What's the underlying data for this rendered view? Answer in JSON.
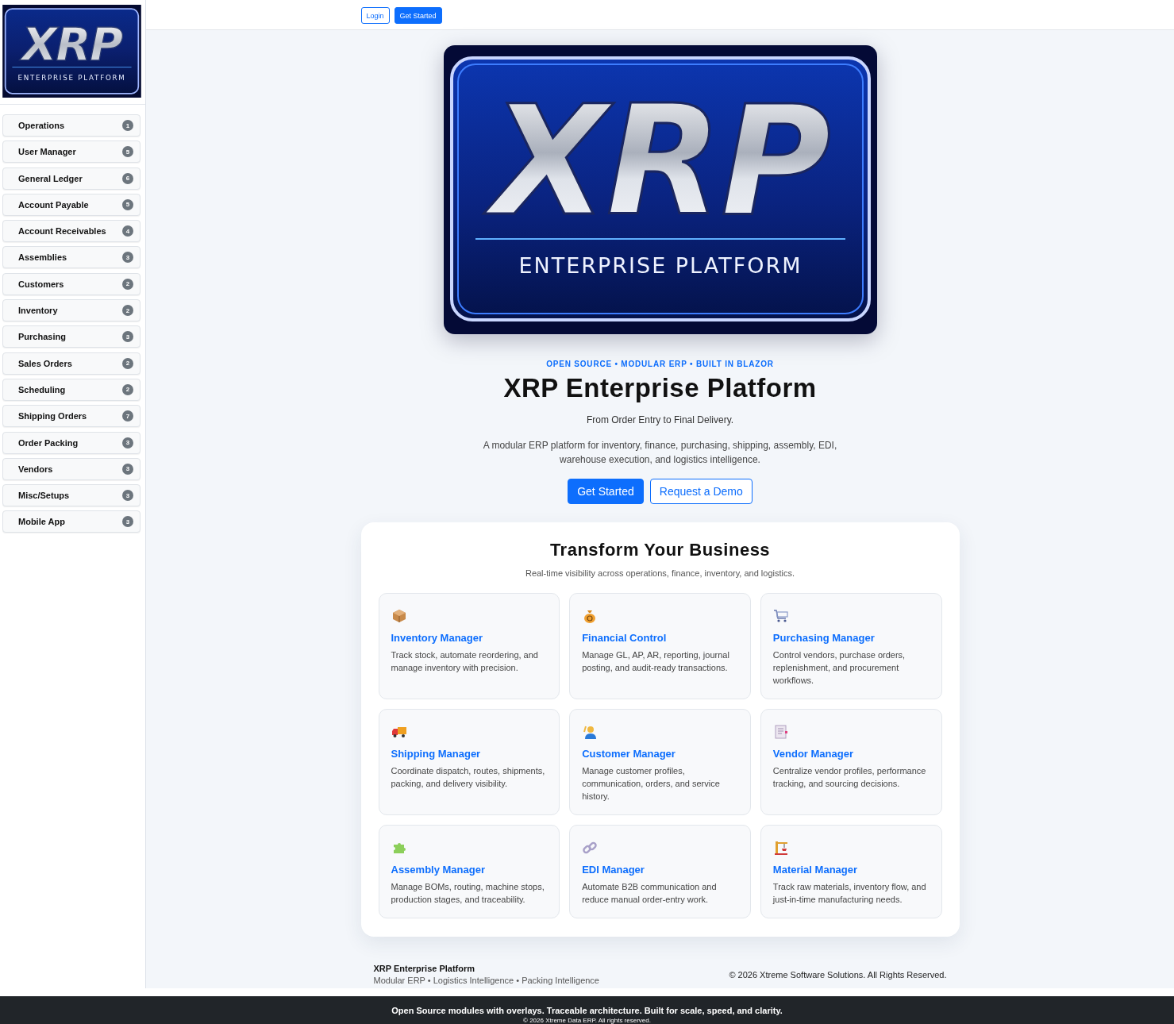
{
  "sidebar": {
    "logo": {
      "title": "XRP",
      "subtitle": "ENTERPRISE PLATFORM"
    },
    "items": [
      {
        "label": "Operations",
        "count": "1"
      },
      {
        "label": "User Manager",
        "count": "5"
      },
      {
        "label": "General Ledger",
        "count": "6"
      },
      {
        "label": "Account Payable",
        "count": "5"
      },
      {
        "label": "Account Receivables",
        "count": "4"
      },
      {
        "label": "Assemblies",
        "count": "3"
      },
      {
        "label": "Customers",
        "count": "2"
      },
      {
        "label": "Inventory",
        "count": "2"
      },
      {
        "label": "Purchasing",
        "count": "3"
      },
      {
        "label": "Sales Orders",
        "count": "2"
      },
      {
        "label": "Scheduling",
        "count": "2"
      },
      {
        "label": "Shipping Orders",
        "count": "7"
      },
      {
        "label": "Order Packing",
        "count": "3"
      },
      {
        "label": "Vendors",
        "count": "3"
      },
      {
        "label": "Misc/Setups",
        "count": "3"
      },
      {
        "label": "Mobile App",
        "count": "3"
      }
    ]
  },
  "top_bar": {
    "buttons": [
      {
        "label": "Login",
        "kind": "outline"
      },
      {
        "label": "Get Started",
        "kind": "primary"
      }
    ]
  },
  "hero": {
    "logo": {
      "title": "XRP",
      "subtitle": "ENTERPRISE PLATFORM"
    },
    "eyebrow": "OPEN SOURCE • MODULAR ERP • BUILT IN BLAZOR",
    "title": "XRP Enterprise Platform",
    "tagline": "From Order Entry to Final Delivery.",
    "description": "A modular ERP platform for inventory, finance, purchasing, shipping, assembly, EDI, warehouse execution, and logistics intelligence.",
    "buttons": [
      {
        "label": "Get Started",
        "kind": "primary"
      },
      {
        "label": "Request a Demo",
        "kind": "outline"
      }
    ]
  },
  "features": {
    "title": "Transform Your Business",
    "subtitle": "Real-time visibility across operations, finance, inventory, and logistics.",
    "cards": [
      {
        "kind": "box",
        "title": "Inventory Manager",
        "text": "Track stock, automate reordering, and manage inventory with precision."
      },
      {
        "kind": "moneybag",
        "title": "Financial Control",
        "text": "Manage GL, AP, AR, reporting, journal posting, and audit-ready transactions."
      },
      {
        "kind": "cart",
        "title": "Purchasing Manager",
        "text": "Control vendors, purchase orders, replenishment, and procurement workflows."
      },
      {
        "kind": "truck",
        "title": "Shipping Manager",
        "text": "Coordinate dispatch, routes, shipments, packing, and delivery visibility."
      },
      {
        "kind": "person",
        "title": "Customer Manager",
        "text": "Manage customer profiles, communication, orders, and service history."
      },
      {
        "kind": "document",
        "title": "Vendor Manager",
        "text": "Centralize vendor profiles, performance tracking, and sourcing decisions."
      },
      {
        "kind": "puzzle",
        "title": "Assembly Manager",
        "text": "Manage BOMs, routing, machine stops, production stages, and traceability."
      },
      {
        "kind": "link",
        "title": "EDI Manager",
        "text": "Automate B2B communication and reduce manual order-entry work."
      },
      {
        "kind": "crane",
        "title": "Material Manager",
        "text": "Track raw materials, inventory flow, and just-in-time manufacturing needs."
      }
    ]
  },
  "page_footer": {
    "brand": "XRP Enterprise Platform",
    "tags": "Modular ERP • Logistics Intelligence • Packing Intelligence",
    "copyright": "© 2026 Xtreme Software Solutions. All Rights Reserved."
  },
  "bottom_bar": {
    "line": "Open Source modules with overlays. Traceable architecture. Built for scale, speed, and clarity.",
    "copyright": "© 2026 Xtreme Data ERP. All rights reserved."
  }
}
